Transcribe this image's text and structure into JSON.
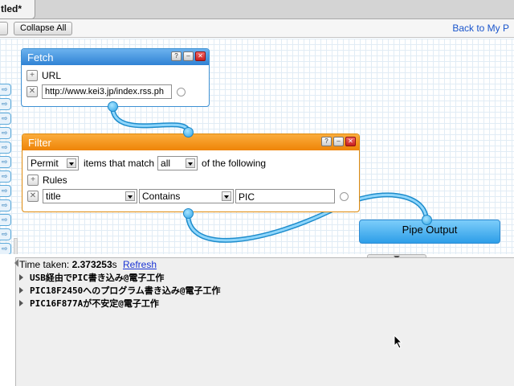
{
  "tab": {
    "title": "tled*"
  },
  "toolbar": {
    "collapse_label": "Collapse All",
    "back_link": "Back to My P"
  },
  "fetch": {
    "title": "Fetch",
    "url_label": "URL",
    "url_value": "http://www.kei3.jp/index.rss.ph"
  },
  "filter": {
    "title": "Filter",
    "mode": "Permit",
    "items_text": "items that match",
    "match": "all",
    "following_text": "of the following",
    "rules_label": "Rules",
    "rule_field": "title",
    "rule_op": "Contains",
    "rule_value": "PIC"
  },
  "pipe_output": {
    "label": "Pipe Output"
  },
  "output": {
    "time_label": "Time taken:",
    "time_value": "2.373253",
    "time_unit": "s",
    "refresh": "Refresh",
    "results": [
      "USB経由でPIC書き込み@電子工作",
      "PIC18F2450へのプログラム書き込み@電子工作",
      "PIC16F877Aが不安定@電子工作"
    ]
  },
  "icons": {
    "module_buttons": [
      "help-icon",
      "minimize-icon",
      "close-icon"
    ],
    "row_controls": [
      "add-icon",
      "remove-icon"
    ]
  },
  "colors": {
    "fetch_header": "#3f93de",
    "filter_header": "#f19213",
    "wire": "#3daee9",
    "link": "#1a55cc"
  }
}
